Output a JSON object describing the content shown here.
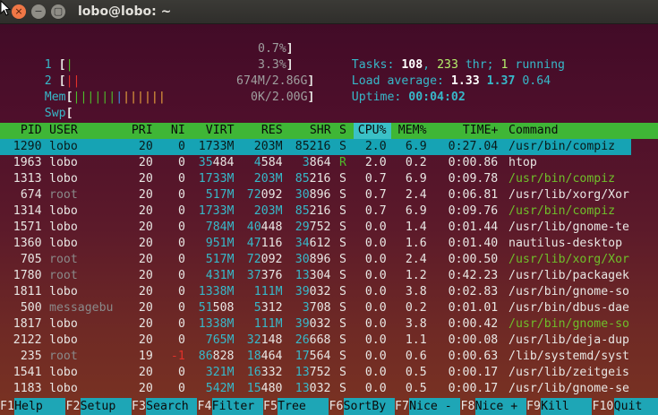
{
  "window": {
    "title": "lobo@lobo: ~",
    "close_glyph": "×",
    "min_glyph": "−",
    "max_glyph": "▢"
  },
  "meters": {
    "cpu1": {
      "label": "1",
      "bars": "|",
      "value": "0.7%"
    },
    "cpu2": {
      "label": "2",
      "bars": "||",
      "value": "3.3%"
    },
    "mem": {
      "label": "Mem",
      "bars_green": "||||||",
      "bars_blue": "|",
      "bars_yellow": "||||||",
      "value": "674M/2.86G"
    },
    "swp": {
      "label": "Swp",
      "bars": "",
      "value": "0K/2.00G"
    }
  },
  "summary": {
    "tasks_label": "Tasks: ",
    "tasks": "108",
    "comma": ", ",
    "threads": "233",
    "thr_label": " thr; ",
    "running": "1",
    "running_label": " running",
    "load_label": "Load average: ",
    "load1": "1.33",
    "load5": "1.37",
    "load15": "0.64",
    "uptime_label": "Uptime: ",
    "uptime": "00:04:02"
  },
  "columns": [
    "PID",
    "USER",
    "PRI",
    "NI",
    "VIRT",
    "RES",
    "SHR",
    "S",
    "CPU%",
    "MEM%",
    "TIME+",
    "Command"
  ],
  "processes": [
    {
      "pid": "1290",
      "user": "lobo",
      "pri": "20",
      "ni": "0",
      "virt": "1733M",
      "res": "203M",
      "shr": "85216",
      "s": "S",
      "cpu": "2.0",
      "mem": "6.9",
      "time": "0:27.04",
      "cmd": "/usr/bin/compiz"
    },
    {
      "pid": "1963",
      "user": "lobo",
      "pri": "20",
      "ni": "0",
      "virt": "35484",
      "res": "4584",
      "shr": "3864",
      "s": "R",
      "cpu": "2.0",
      "mem": "0.2",
      "time": "0:00.86",
      "cmd": "htop"
    },
    {
      "pid": "1313",
      "user": "lobo",
      "pri": "20",
      "ni": "0",
      "virt": "1733M",
      "res": "203M",
      "shr": "85216",
      "s": "S",
      "cpu": "0.7",
      "mem": "6.9",
      "time": "0:09.78",
      "cmd": "/usr/bin/compiz"
    },
    {
      "pid": "674",
      "user": "root",
      "pri": "20",
      "ni": "0",
      "virt": "517M",
      "res": "72092",
      "shr": "30896",
      "s": "S",
      "cpu": "0.7",
      "mem": "2.4",
      "time": "0:06.81",
      "cmd": "/usr/lib/xorg/Xor"
    },
    {
      "pid": "1314",
      "user": "lobo",
      "pri": "20",
      "ni": "0",
      "virt": "1733M",
      "res": "203M",
      "shr": "85216",
      "s": "S",
      "cpu": "0.7",
      "mem": "6.9",
      "time": "0:09.76",
      "cmd": "/usr/bin/compiz"
    },
    {
      "pid": "1571",
      "user": "lobo",
      "pri": "20",
      "ni": "0",
      "virt": "784M",
      "res": "40448",
      "shr": "29752",
      "s": "S",
      "cpu": "0.0",
      "mem": "1.4",
      "time": "0:01.44",
      "cmd": "/usr/lib/gnome-te"
    },
    {
      "pid": "1360",
      "user": "lobo",
      "pri": "20",
      "ni": "0",
      "virt": "951M",
      "res": "47116",
      "shr": "34612",
      "s": "S",
      "cpu": "0.0",
      "mem": "1.6",
      "time": "0:01.40",
      "cmd": "nautilus-desktop"
    },
    {
      "pid": "705",
      "user": "root",
      "pri": "20",
      "ni": "0",
      "virt": "517M",
      "res": "72092",
      "shr": "30896",
      "s": "S",
      "cpu": "0.0",
      "mem": "2.4",
      "time": "0:00.50",
      "cmd": "/usr/lib/xorg/Xor"
    },
    {
      "pid": "1780",
      "user": "root",
      "pri": "20",
      "ni": "0",
      "virt": "431M",
      "res": "37376",
      "shr": "13304",
      "s": "S",
      "cpu": "0.0",
      "mem": "1.2",
      "time": "0:42.23",
      "cmd": "/usr/lib/packagek"
    },
    {
      "pid": "1811",
      "user": "lobo",
      "pri": "20",
      "ni": "0",
      "virt": "1338M",
      "res": "111M",
      "shr": "39032",
      "s": "S",
      "cpu": "0.0",
      "mem": "3.8",
      "time": "0:02.83",
      "cmd": "/usr/bin/gnome-so"
    },
    {
      "pid": "500",
      "user": "messagebu",
      "pri": "20",
      "ni": "0",
      "virt": "51508",
      "res": "5312",
      "shr": "3708",
      "s": "S",
      "cpu": "0.0",
      "mem": "0.2",
      "time": "0:01.01",
      "cmd": "/usr/bin/dbus-dae"
    },
    {
      "pid": "1817",
      "user": "lobo",
      "pri": "20",
      "ni": "0",
      "virt": "1338M",
      "res": "111M",
      "shr": "39032",
      "s": "S",
      "cpu": "0.0",
      "mem": "3.8",
      "time": "0:00.42",
      "cmd": "/usr/bin/gnome-so"
    },
    {
      "pid": "2122",
      "user": "lobo",
      "pri": "20",
      "ni": "0",
      "virt": "765M",
      "res": "32148",
      "shr": "26668",
      "s": "S",
      "cpu": "0.0",
      "mem": "1.1",
      "time": "0:00.08",
      "cmd": "/usr/lib/deja-dup"
    },
    {
      "pid": "235",
      "user": "root",
      "pri": "19",
      "ni": "-1",
      "virt": "86828",
      "res": "18464",
      "shr": "17564",
      "s": "S",
      "cpu": "0.0",
      "mem": "0.6",
      "time": "0:00.63",
      "cmd": "/lib/systemd/syst"
    },
    {
      "pid": "1541",
      "user": "lobo",
      "pri": "20",
      "ni": "0",
      "virt": "321M",
      "res": "16332",
      "shr": "13752",
      "s": "S",
      "cpu": "0.0",
      "mem": "0.5",
      "time": "0:00.17",
      "cmd": "/usr/lib/zeitgeis"
    },
    {
      "pid": "1183",
      "user": "lobo",
      "pri": "20",
      "ni": "0",
      "virt": "542M",
      "res": "15480",
      "shr": "13032",
      "s": "S",
      "cpu": "0.0",
      "mem": "0.5",
      "time": "0:00.17",
      "cmd": "/usr/lib/gnome-se"
    }
  ],
  "footer": [
    {
      "key": "F1",
      "label": "Help  "
    },
    {
      "key": "F2",
      "label": "Setup "
    },
    {
      "key": "F3",
      "label": "Search"
    },
    {
      "key": "F4",
      "label": "Filter"
    },
    {
      "key": "F5",
      "label": "Tree  "
    },
    {
      "key": "F6",
      "label": "SortBy"
    },
    {
      "key": "F7",
      "label": "Nice -"
    },
    {
      "key": "F8",
      "label": "Nice +"
    },
    {
      "key": "F9",
      "label": "Kill  "
    },
    {
      "key": "F10",
      "label": "Quit  "
    }
  ],
  "colors": {
    "header_bg": "#3fb636",
    "sorted_col_bg": "#3ac1c7",
    "selected_row_bg": "#16a3b4",
    "footer_label_bg": "#1ea6b6",
    "cyan_text": "#37b8c9",
    "path_green": "#6fbf2a",
    "close_button": "#f07746"
  }
}
